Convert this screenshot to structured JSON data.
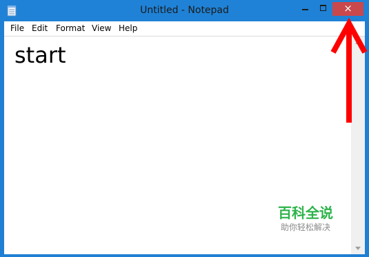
{
  "window": {
    "title": "Untitled - Notepad",
    "close_symbol": "×"
  },
  "menu": {
    "items": [
      "File",
      "Edit",
      "Format",
      "View",
      "Help"
    ]
  },
  "editor": {
    "content": "start"
  },
  "watermark": {
    "main": "百科全说",
    "sub": "助你轻松解决"
  },
  "annotation": {
    "arrow_color": "#ff0000",
    "arrow_target": "close-button"
  },
  "colors": {
    "titlebar": "#1f82d6",
    "close_button": "#c9484b",
    "watermark_green": "#2db34a"
  }
}
